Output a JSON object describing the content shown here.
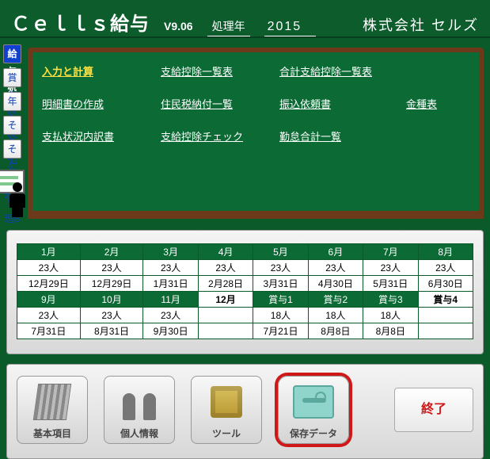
{
  "header": {
    "app_name": "Ｃｅｌｌｓ給与",
    "version": "V9.06",
    "year_label": "処理年",
    "year_value": "2015",
    "company": "株式会社 セルズ"
  },
  "sidebar": {
    "items": [
      {
        "label": "給与処理",
        "active": true
      },
      {
        "label": "賞与処理",
        "active": false
      },
      {
        "label": "年末処理",
        "active": false
      },
      {
        "label": "その他処理A",
        "active": false
      },
      {
        "label": "その他処理B",
        "active": false
      }
    ]
  },
  "board": {
    "links": [
      [
        "入力と計算",
        "支給控除一覧表",
        "合計支給控除一覧表",
        ""
      ],
      [
        "明細書の作成",
        "住民税納付一覧",
        "振込依頼書",
        "金種表"
      ],
      [
        "支払状況内訳書",
        "支給控除チェック",
        "勤怠合計一覧",
        ""
      ]
    ],
    "highlight_row": 0,
    "highlight_col": 0
  },
  "calendar": {
    "months_row1": [
      "1月",
      "2月",
      "3月",
      "4月",
      "5月",
      "6月",
      "7月",
      "8月"
    ],
    "counts_row1": [
      "23人",
      "23人",
      "23人",
      "23人",
      "23人",
      "23人",
      "23人",
      "23人"
    ],
    "dates_row1": [
      "12月29日",
      "12月29日",
      "1月31日",
      "2月28日",
      "3月31日",
      "4月30日",
      "5月31日",
      "6月30日"
    ],
    "months_row2": [
      "9月",
      "10月",
      "11月",
      "12月",
      "賞与1",
      "賞与2",
      "賞与3",
      "賞与4"
    ],
    "selected_month_idx": 3,
    "selected_bonus_idx": 7,
    "counts_row2": [
      "23人",
      "23人",
      "23人",
      "",
      "18人",
      "18人",
      "18人",
      ""
    ],
    "dates_row2": [
      "7月31日",
      "8月31日",
      "9月30日",
      "",
      "7月21日",
      "8月8日",
      "8月8日",
      ""
    ]
  },
  "toolbar": {
    "items": [
      {
        "name": "basic",
        "label": "基本項目"
      },
      {
        "name": "person",
        "label": "個人情報"
      },
      {
        "name": "tools",
        "label": "ツール"
      },
      {
        "name": "save",
        "label": "保存データ",
        "highlight": true
      }
    ],
    "exit_label": "終了"
  }
}
